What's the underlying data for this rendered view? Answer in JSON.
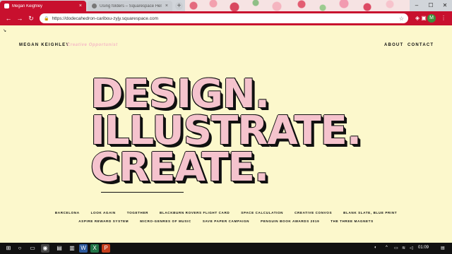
{
  "browser": {
    "tabs": [
      {
        "title": "Megan Keighley",
        "close": "×"
      },
      {
        "title": "Using folders – Squarespace Hel",
        "close": "×"
      }
    ],
    "new_tab": "+",
    "window_controls": {
      "minimize": "–",
      "maximize": "☐",
      "close": "✕"
    },
    "url": "https://dodecahedron-caribou-zyjy.squarespace.com",
    "avatar_initial": "M"
  },
  "site": {
    "brand": "MEGAN KEIGHLEY",
    "tagline": "Creative Opportunist",
    "nav": [
      "ABOUT",
      "CONTACT"
    ],
    "hero": [
      "DESIGN.",
      "ILLUSTRATE.",
      "CREATE."
    ],
    "project_links_row1": [
      "BARCELONA",
      "LOOK AGAIN",
      "TOGETHER",
      "BLACKBURN ROVERS FLIGHT CARD",
      "SPACE CALCULATION",
      "CREATIVE CONVOS",
      "BLANK SLATE, BLUE PRINT"
    ],
    "project_links_row2": [
      "ASPIRE REWARD SYSTEM",
      "MICRO-GENRES OF MUSIC",
      "SAVE PAPER CAMPAIGN",
      "PENGUIN BOOK AWARDS 2019",
      "THE THREE MAGNETS"
    ]
  },
  "taskbar": {
    "time": "01:09"
  },
  "colors": {
    "brand_red": "#c8102e",
    "page_bg": "#fcf8cc",
    "hero_pink": "#f5c3cd"
  }
}
